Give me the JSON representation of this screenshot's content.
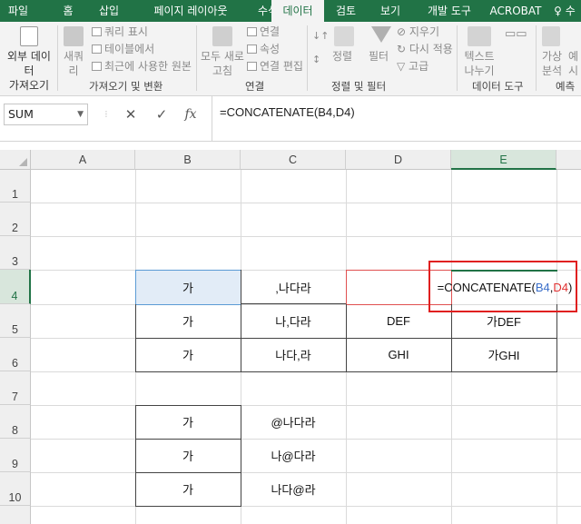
{
  "ribbon_tabs": [
    "파일",
    "홈",
    "삽입",
    "페이지 레이아웃",
    "수식",
    "데이터",
    "검토",
    "보기",
    "개발 도구",
    "ACROBAT",
    "♀ 수"
  ],
  "active_tab_index": 5,
  "ribbon": {
    "get_external_data": "외부 데이터\n가져오기",
    "new_query": "새쿼\n리",
    "show_queries": "쿼리 표시",
    "from_table": "테이블에서",
    "recent_sources": "최근에 사용한 원본",
    "group_get_transform": "가져오기 및 변환",
    "refresh_all": "모두 새로\n고침",
    "connections": "연결",
    "properties": "속성",
    "edit_links": "연결 편집",
    "group_connections": "연결",
    "sort": "정렬",
    "filter": "필터",
    "clear": "지우기",
    "reapply": "다시 적용",
    "advanced": "고급",
    "group_sort_filter": "정렬 및 필터",
    "text_to_columns": "텍스트\n나누기",
    "group_data_tools": "데이터 도구",
    "what_if": "가상\n분석",
    "forecast_sheet": "예\n시",
    "group_forecast": "예측"
  },
  "formula_bar": {
    "name_box": "SUM",
    "cancel": "✕",
    "enter": "✓",
    "fx": "fx",
    "formula": "=CONCATENATE(B4,D4)"
  },
  "columns": [
    "A",
    "B",
    "C",
    "D",
    "E"
  ],
  "rows": [
    "1",
    "2",
    "3",
    "4",
    "5",
    "6",
    "7",
    "8",
    "9",
    "10"
  ],
  "cells": {
    "B4": "가",
    "C4": ",나다라",
    "D4": "",
    "E4_prefix": "=CONCATENATE(",
    "E4_ref1": "B4",
    "E4_comma": ",",
    "E4_ref2": "D4",
    "E4_suffix": ")",
    "B5": "가",
    "C5": "나,다라",
    "D5": "DEF",
    "E5": "가DEF",
    "B6": "가",
    "C6": "나다,라",
    "D6": "GHI",
    "E6": "가GHI",
    "B8": "가",
    "C8": "@나다라",
    "B9": "가",
    "C9": "나@다라",
    "B10": "가",
    "C10": "나다@라"
  },
  "colors": {
    "accent": "#217346",
    "ref1": "#3b6fc9",
    "ref2": "#e03030",
    "highlight": "#e02020"
  }
}
